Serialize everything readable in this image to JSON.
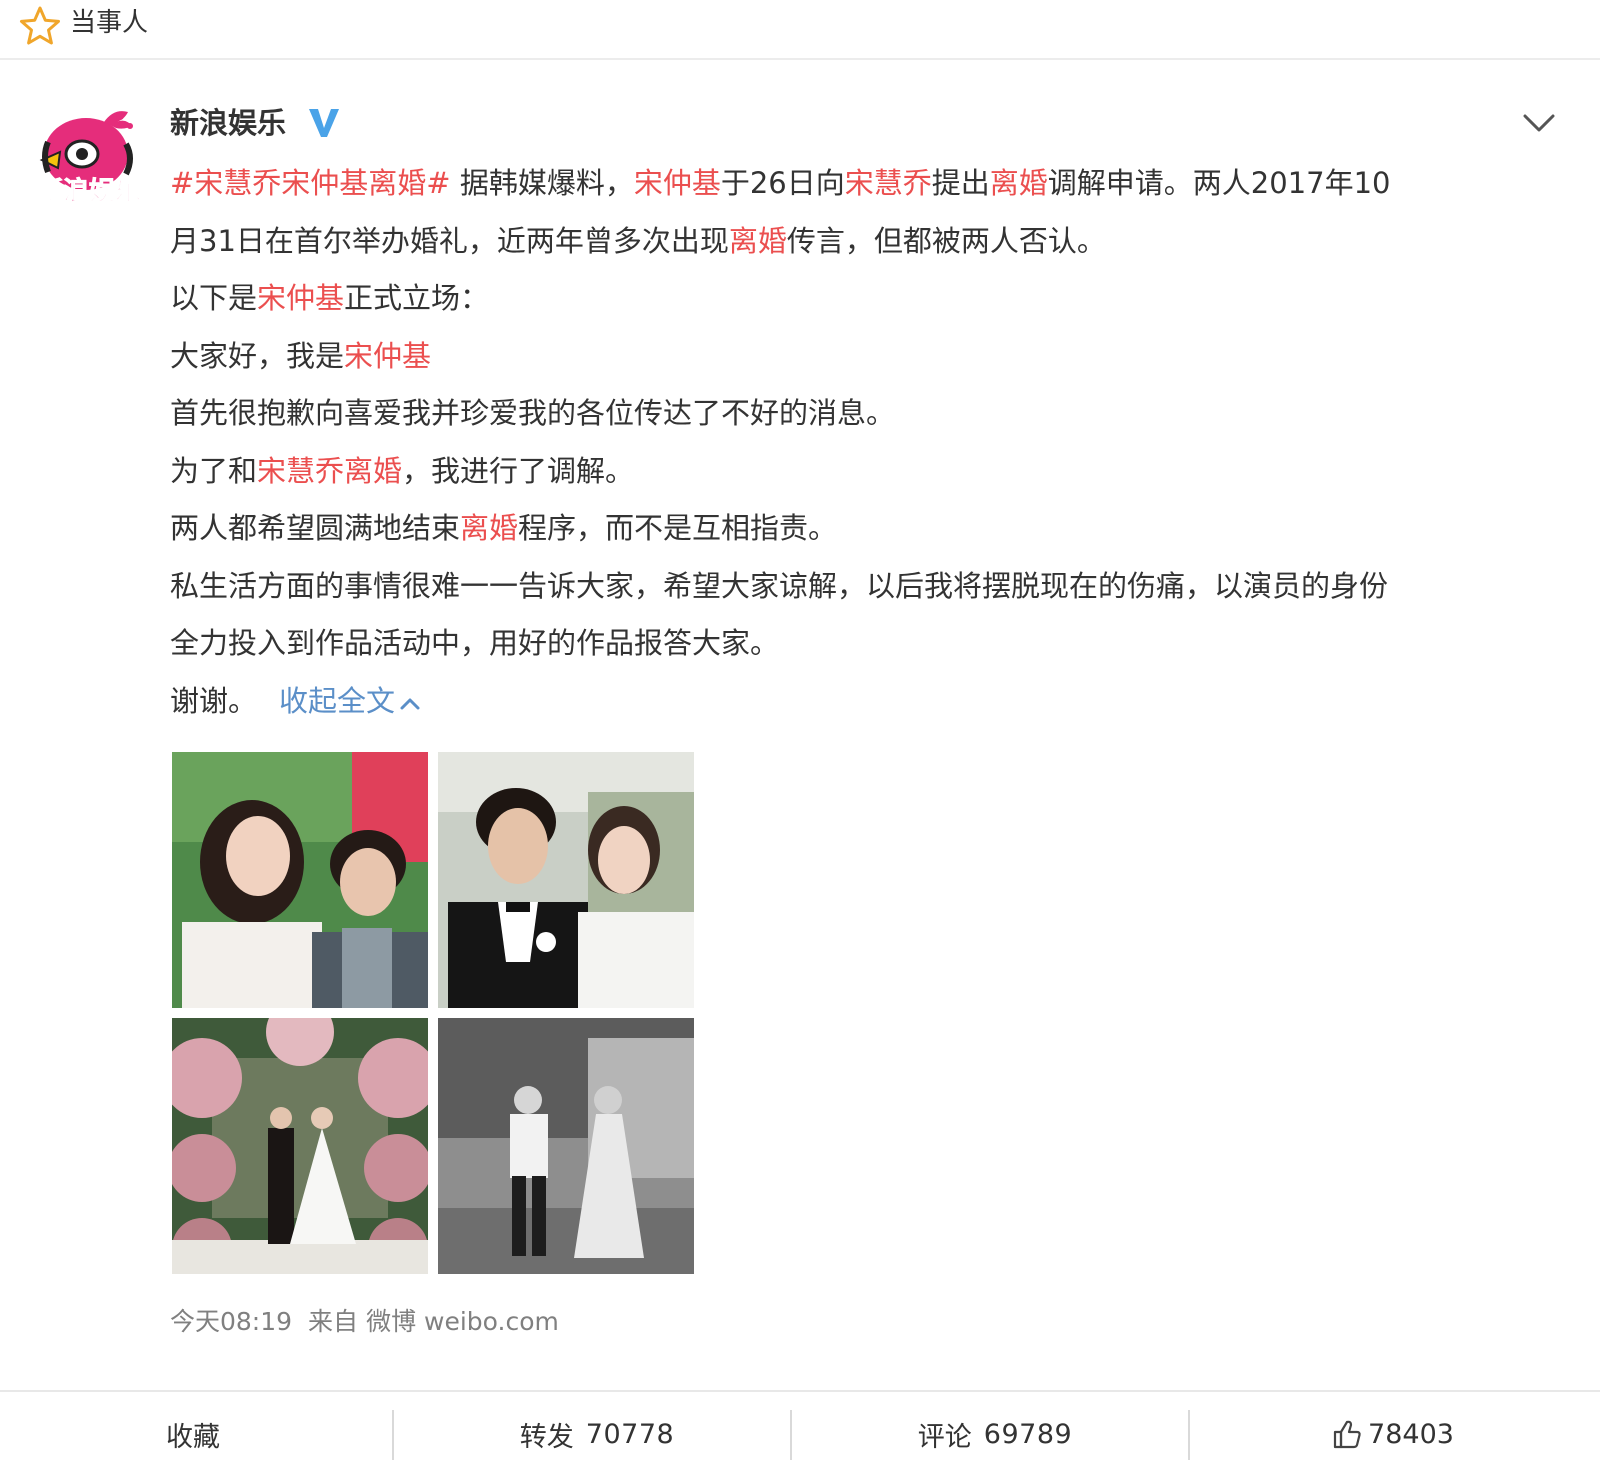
{
  "topbar": {
    "label": "当事人",
    "icon": "star-icon"
  },
  "post": {
    "username": "新浪娱乐",
    "avatar_text": "新浪娱乐",
    "verified_icon": "verified-v-icon",
    "hashtag": "#宋慧乔宋仲基离婚#",
    "line1_a": " 据韩媒爆料，",
    "line1_name1": "宋仲基",
    "line1_b": "于26日向",
    "line1_name2": "宋慧乔",
    "line1_c": "提出",
    "line1_kw": "离婚",
    "line1_d": "调解申请。两人2017年10",
    "line2_a": "月31日在首尔举办婚礼，近两年曾多次出现",
    "line2_kw": "离婚",
    "line2_b": "传言，但都被两人否认。",
    "line3_a": "以下是",
    "line3_name": "宋仲基",
    "line3_b": "正式立场：",
    "line4_a": "大家好，我是",
    "line4_name": "宋仲基",
    "line5": "首先很抱歉向喜爱我并珍爱我的各位传达了不好的消息。",
    "line6_a": "为了和",
    "line6_name": "宋慧乔",
    "line6_kw": "离婚",
    "line6_b": "，我进行了调解。",
    "line7_a": "两人都希望圆满地结束",
    "line7_kw": "离婚",
    "line7_b": "程序，而不是互相指责。",
    "line8": "私生活方面的事情很难一一告诉大家，希望大家谅解，以后我将摆脱现在的伤痛，以演员的身份",
    "line9": "全力投入到作品活动中，用好的作品报答大家。",
    "line10": "谢谢。",
    "collapse_label": "收起全文",
    "time": "今天08:19",
    "from_label": "来自",
    "source": "微博 weibo.com"
  },
  "actions": {
    "favorite_label": "收藏",
    "repost_label": "转发",
    "repost_count": "70778",
    "comment_label": "评论",
    "comment_count": "69789",
    "like_count": "78403",
    "like_icon": "thumbs-up-icon"
  },
  "colors": {
    "highlight": "#eb4f4f",
    "link_blue": "#5b8fc8",
    "meta_gray": "#808080",
    "verified_blue": "#4aa3e8"
  }
}
